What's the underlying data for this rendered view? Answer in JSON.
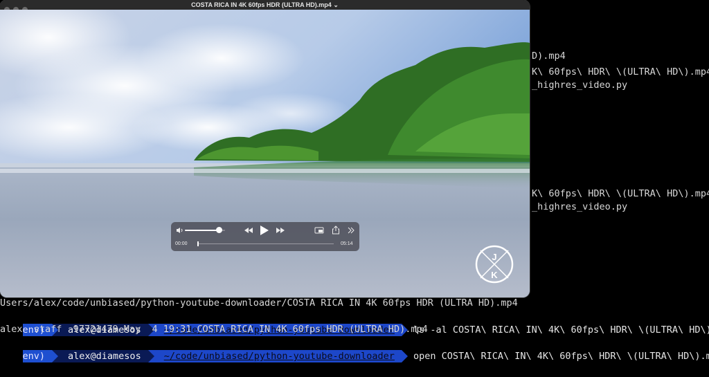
{
  "window": {
    "title": "COSTA RICA IN 4K 60fps HDR (ULTRA HD).mp4 ⌄"
  },
  "player": {
    "time_current": "00:00",
    "time_total": "05:14",
    "volume_fraction": 0.85,
    "progress_fraction": 0.0,
    "watermark_letters": [
      "J",
      "K"
    ]
  },
  "terminal": {
    "right_fragments": [
      "D).mp4",
      "K\\ 60fps\\ HDR\\ \\(ULTRA\\ HD\\).mp4",
      "_highres_video.py",
      "K\\ 60fps\\ HDR\\ \\(ULTRA\\ HD\\).mp4",
      "_highres_video.py"
    ],
    "line_path": "Users/alex/code/unbiased/python-youtube-downloader/COSTA RICA IN 4K 60fps HDR (ULTRA HD).mp4",
    "prompt1": {
      "venv": "env)",
      "user": "alex@diamesos",
      "path": "~/code/unbiased/python-youtube-downloader",
      "command": "ls -al COSTA\\ RICA\\ IN\\ 4K\\ 60fps\\ HDR\\ \\(ULTRA\\ HD\\).mp4"
    },
    "ls_output": "alex  staff  97721479 May  4 19:31 COSTA RICA IN 4K 60fps HDR (ULTRA HD).mp4",
    "prompt2": {
      "venv": "env)",
      "user": "alex@diamesos",
      "path": "~/code/unbiased/python-youtube-downloader",
      "command": "open COSTA\\ RICA\\ IN\\ 4K\\ 60fps\\ HDR\\ \\(ULTRA\\ HD\\).mp4"
    }
  },
  "colors": {
    "terminal_bg": "#000000",
    "prompt_venv": "#1e4fd0",
    "prompt_user": "#0a1a55",
    "prompt_path": "#1d47c9"
  }
}
